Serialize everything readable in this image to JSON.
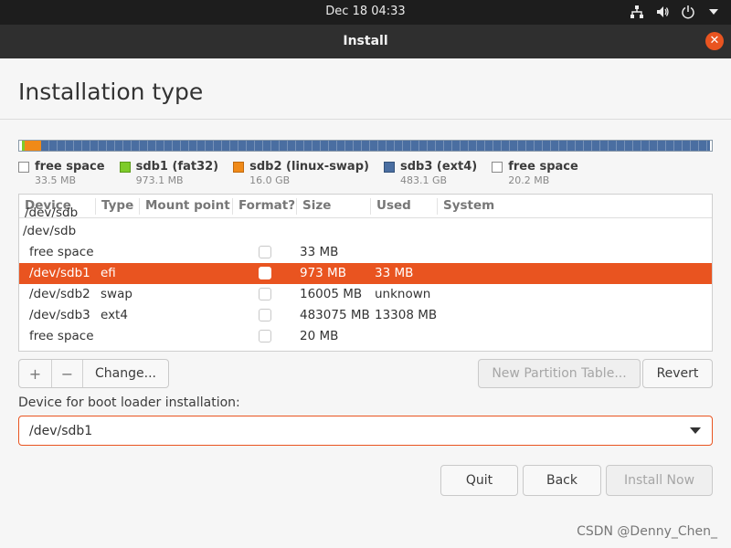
{
  "topbar": {
    "clock": "Dec 18  04:33",
    "icons": [
      "network-icon",
      "volume-icon",
      "power-icon",
      "chevron-down-icon"
    ]
  },
  "window": {
    "title": "Install",
    "close_icon": "close-icon"
  },
  "page": {
    "title": "Installation type"
  },
  "colors": {
    "accent": "#e95420",
    "free": "#ffffff",
    "fat32": "#7ecb2a",
    "swap": "#f08a18",
    "ext4": "#4a6ea1"
  },
  "partition_bar": [
    {
      "label": "free space",
      "size": "33.5 MB",
      "fraction": 0.0001,
      "color": "#ffffff"
    },
    {
      "label": "sdb1 (fat32)",
      "size": "973.1 MB",
      "fraction": 0.002,
      "color": "#7ecb2a"
    },
    {
      "label": "sdb2 (linux-swap)",
      "size": "16.0 GB",
      "fraction": 0.032,
      "color": "#f08a18"
    },
    {
      "label": "sdb3 (ext4)",
      "size": "483.1 GB",
      "fraction": 0.966,
      "color": "#4a6ea1"
    },
    {
      "label": "free space",
      "size": "20.2 MB",
      "fraction": 0.0001,
      "color": "#ffffff"
    }
  ],
  "table": {
    "headers": [
      "Device",
      "Type",
      "Mount point",
      "Format?",
      "Size",
      "Used",
      "System"
    ],
    "rows": [
      {
        "device": "/dev/sdb",
        "type": "",
        "size": "",
        "used": "",
        "checkbox": false,
        "selected": false,
        "clipped": true
      },
      {
        "device": "/dev/sdb",
        "type": "",
        "size": "",
        "used": "",
        "checkbox": false,
        "selected": false
      },
      {
        "device": "free space",
        "type": "",
        "size": "33 MB",
        "used": "",
        "checkbox": true,
        "selected": false
      },
      {
        "device": "/dev/sdb1",
        "type": "efi",
        "size": "973 MB",
        "used": "33 MB",
        "checkbox": true,
        "selected": true
      },
      {
        "device": "/dev/sdb2",
        "type": "swap",
        "size": "16005 MB",
        "used": "unknown",
        "checkbox": true,
        "selected": false
      },
      {
        "device": "/dev/sdb3",
        "type": "ext4",
        "size": "483075 MB",
        "used": "13308 MB",
        "checkbox": true,
        "selected": false
      },
      {
        "device": "free space",
        "type": "",
        "size": "20 MB",
        "used": "",
        "checkbox": true,
        "selected": false
      }
    ]
  },
  "controls": {
    "add": "+",
    "remove": "−",
    "change": "Change...",
    "new_table": "New Partition Table...",
    "revert": "Revert"
  },
  "bootloader": {
    "label": "Device for boot loader installation:",
    "value": "/dev/sdb1"
  },
  "footer": {
    "quit": "Quit",
    "back": "Back",
    "install_now": "Install Now"
  },
  "watermark": "CSDN @Denny_Chen_"
}
